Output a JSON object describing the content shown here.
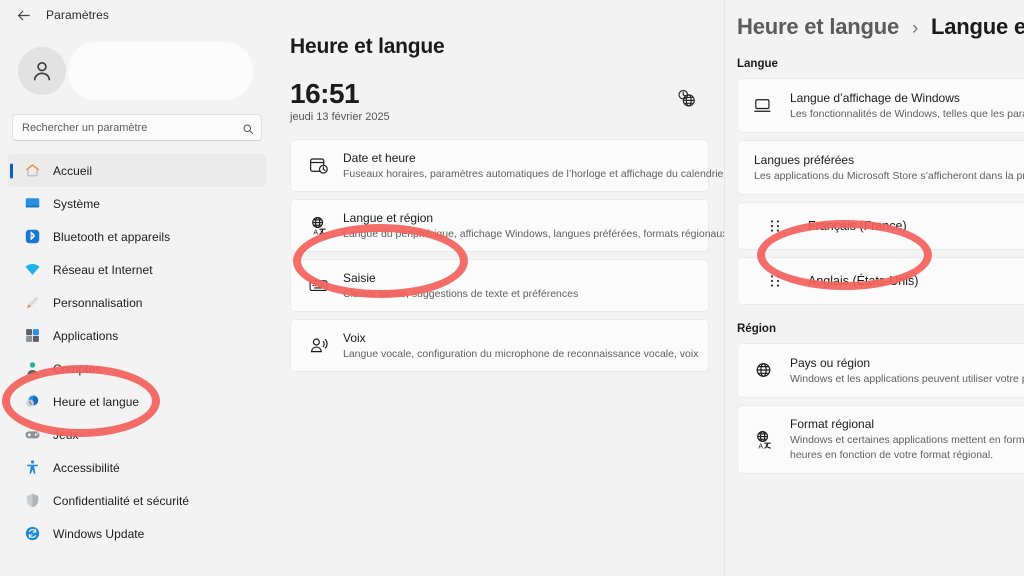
{
  "window": {
    "back_label": "back-arrow",
    "title": "Paramètres"
  },
  "sidebar": {
    "account": {
      "name": ""
    },
    "search": {
      "placeholder": "Rechercher un paramètre",
      "value": ""
    },
    "items": [
      {
        "label": "Accueil",
        "icon": "home-icon",
        "selected": true
      },
      {
        "label": "Système",
        "icon": "monitor-icon",
        "selected": false
      },
      {
        "label": "Bluetooth et appareils",
        "icon": "bluetooth-icon",
        "selected": false
      },
      {
        "label": "Réseau et Internet",
        "icon": "wifi-icon",
        "selected": false
      },
      {
        "label": "Personnalisation",
        "icon": "paintbrush-icon",
        "selected": false
      },
      {
        "label": "Applications",
        "icon": "apps-icon",
        "selected": false
      },
      {
        "label": "Comptes",
        "icon": "person-icon",
        "selected": false
      },
      {
        "label": "Heure et langue",
        "icon": "clock-globe-icon",
        "selected": false
      },
      {
        "label": "Jeux",
        "icon": "gaming-icon",
        "selected": false
      },
      {
        "label": "Accessibilité",
        "icon": "accessibility-icon",
        "selected": false
      },
      {
        "label": "Confidentialité et sécurité",
        "icon": "shield-icon",
        "selected": false
      },
      {
        "label": "Windows Update",
        "icon": "update-icon",
        "selected": false
      }
    ]
  },
  "center": {
    "page_title": "Heure et langue",
    "clock": {
      "time": "16:51",
      "date": "jeudi 13 février 2025",
      "icon": "world-clock-icon"
    },
    "cards": [
      {
        "title": "Date et heure",
        "subtitle": "Fuseaux horaires, paramètres automatiques de l’horloge et affichage du calendrier",
        "icon": "calendar-clock-icon"
      },
      {
        "title": "Langue et région",
        "subtitle": "Langue du périphérique, affichage Windows, langues préférées, formats régionaux",
        "icon": "language-region-icon"
      },
      {
        "title": "Saisie",
        "subtitle": "Clavier tactile, suggestions de texte et préférences",
        "icon": "keyboard-icon"
      },
      {
        "title": "Voix",
        "subtitle": "Langue vocale, configuration du microphone de reconnaissance vocale, voix",
        "icon": "speech-icon"
      }
    ]
  },
  "right": {
    "breadcrumb": {
      "parent": "Heure et langue",
      "separator": "›",
      "current": "Langue et région"
    },
    "language_section": {
      "label": "Langue",
      "cards": [
        {
          "title": "Langue d’affichage de Windows",
          "subtitle": "Les fonctionnalités de Windows, telles que les paramètres et l’Explorateur de fichiers, s’afficheront dans cette langue.",
          "icon": "display-language-icon"
        },
        {
          "title": "Langues préférées",
          "subtitle": "Les applications du Microsoft Store s’afficheront dans la première langue prise en charge de la liste.",
          "icon": ""
        }
      ],
      "preferred_languages": [
        {
          "name": "Français (France)",
          "handle": "drag-handle-icon"
        },
        {
          "name": "Anglais (États-Unis)",
          "handle": "drag-handle-icon"
        }
      ]
    },
    "region_section": {
      "label": "Région",
      "cards": [
        {
          "title": "Pays ou région",
          "subtitle": "Windows et les applications peuvent utiliser votre pays ou région pour vous proposer du contenu local.",
          "icon": "globe-icon"
        },
        {
          "title": "Format régional",
          "subtitle": "Windows et certaines applications mettent en forme les dates et heures en fonction de votre format régional.",
          "icon": "regional-format-icon"
        }
      ]
    }
  },
  "annotations": {
    "color": "#f4615c",
    "highlights": [
      {
        "target": "sidebar-item-heure-et-langue"
      },
      {
        "target": "center-card-langue-et-region"
      },
      {
        "target": "preferred-language-francais-france"
      }
    ]
  }
}
